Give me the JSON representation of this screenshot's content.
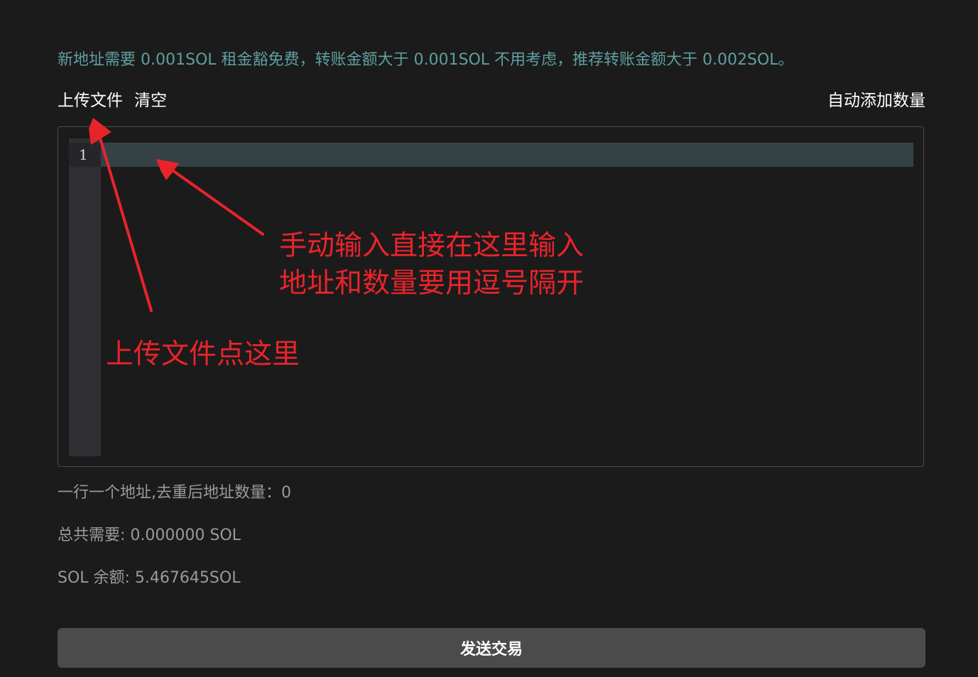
{
  "notice": "新地址需要 0.001SOL 租金豁免费，转账金额大于 0.001SOL 不用考虑，推荐转账金额大于 0.002SOL。",
  "toolbar": {
    "upload_label": "上传文件",
    "clear_label": "清空",
    "auto_add_label": "自动添加数量"
  },
  "editor": {
    "line_numbers": [
      "1"
    ],
    "content": ""
  },
  "info": {
    "address_count": "一行一个地址,去重后地址数量：0",
    "total_needed": "总共需要: 0.000000 SOL",
    "balance": "SOL 余额: 5.467645SOL"
  },
  "send_label": "发送交易",
  "annotations": {
    "manual_line1": "手动输入直接在这里输入",
    "manual_line2": "地址和数量要用逗号隔开",
    "upload_hint": "上传文件点这里",
    "color": "#e8242b"
  }
}
